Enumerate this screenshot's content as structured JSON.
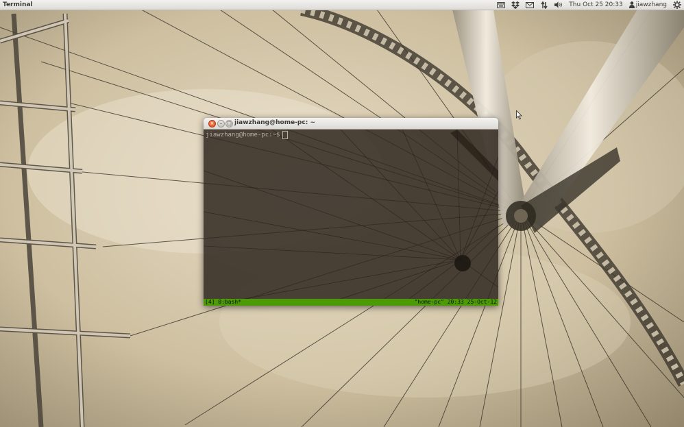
{
  "top_panel": {
    "app_title": "Terminal",
    "clock": "Thu Oct 25 20:33",
    "username": "jiawzhang",
    "indicators": [
      "keyboard-icon",
      "dropbox-icon",
      "mail-icon",
      "network-icon",
      "volume-icon",
      "user-icon",
      "gear-icon"
    ]
  },
  "terminal_window": {
    "title": "jiawzhang@home-pc: ~",
    "close_glyph": "×",
    "minimize_glyph": "–",
    "maximize_glyph": "□",
    "prompt": "jiawzhang@home-pc:~$",
    "status_left": "[4] 0:bash*",
    "status_right": "\"home-pc\" 20:33 25-Oct-12"
  },
  "colors": {
    "status_bar": "#4c9a06",
    "close_button": "#df4a16",
    "panel": "#dedcd8"
  }
}
